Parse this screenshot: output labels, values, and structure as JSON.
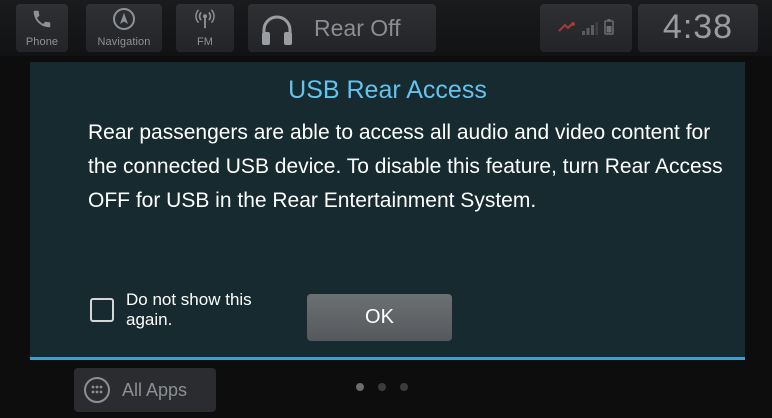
{
  "top_bar": {
    "shortcuts": [
      {
        "label": "Phone",
        "icon": "phone-icon"
      },
      {
        "label": "Navigation",
        "icon": "navigation-icon"
      },
      {
        "label": "FM",
        "icon": "radio-icon"
      }
    ],
    "audio_source": {
      "icon": "headphones-icon",
      "label": "Rear Off"
    },
    "status_icons": [
      "usb-icon",
      "signal-icon",
      "battery-icon"
    ],
    "clock": "4:38"
  },
  "home": {
    "all_apps_label": "All Apps",
    "page_count": 3,
    "active_page": 1
  },
  "dialog": {
    "title": "USB Rear Access",
    "body": "Rear passengers are able to access all audio and video content for the connected USB device. To disable this feature, turn Rear Access OFF for USB in the Rear Entertainment System.",
    "checkbox_label": "Do not show this again.",
    "checkbox_checked": false,
    "ok_label": "OK"
  },
  "colors": {
    "dialog_bg": "#162a30",
    "title": "#63c3ee",
    "accent": "#3aa2d2"
  }
}
